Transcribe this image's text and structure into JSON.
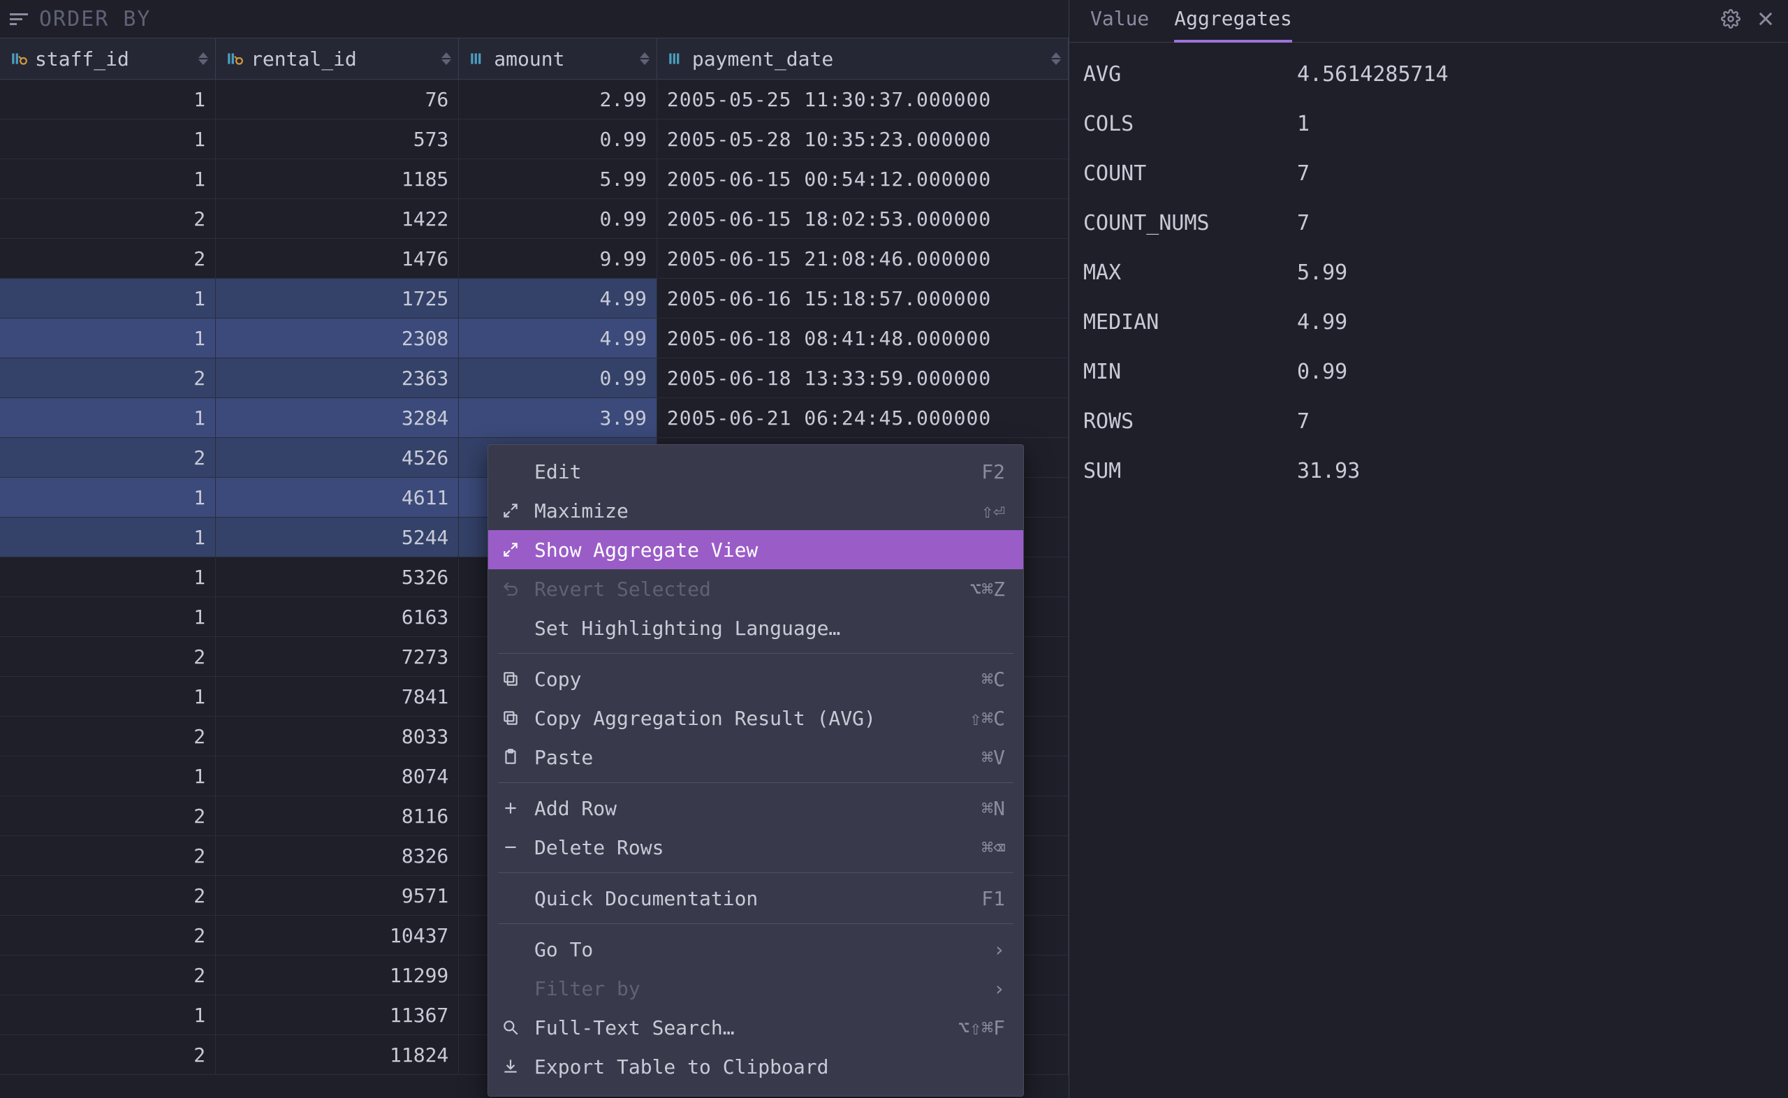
{
  "orderbar": {
    "label": "ORDER BY"
  },
  "columns": [
    {
      "name": "staff_id",
      "icon": "fk"
    },
    {
      "name": "rental_id",
      "icon": "fk"
    },
    {
      "name": "amount",
      "icon": "col"
    },
    {
      "name": "payment_date",
      "icon": "col"
    }
  ],
  "rows": [
    {
      "staff_id": "1",
      "rental_id": "76",
      "amount": "2.99",
      "payment_date": "2005-05-25 11:30:37.000000",
      "sel": false
    },
    {
      "staff_id": "1",
      "rental_id": "573",
      "amount": "0.99",
      "payment_date": "2005-05-28 10:35:23.000000",
      "sel": false
    },
    {
      "staff_id": "1",
      "rental_id": "1185",
      "amount": "5.99",
      "payment_date": "2005-06-15 00:54:12.000000",
      "sel": false
    },
    {
      "staff_id": "2",
      "rental_id": "1422",
      "amount": "0.99",
      "payment_date": "2005-06-15 18:02:53.000000",
      "sel": false
    },
    {
      "staff_id": "2",
      "rental_id": "1476",
      "amount": "9.99",
      "payment_date": "2005-06-15 21:08:46.000000",
      "sel": false
    },
    {
      "staff_id": "1",
      "rental_id": "1725",
      "amount": "4.99",
      "payment_date": "2005-06-16 15:18:57.000000",
      "sel": true
    },
    {
      "staff_id": "1",
      "rental_id": "2308",
      "amount": "4.99",
      "payment_date": "2005-06-18 08:41:48.000000",
      "sel": true
    },
    {
      "staff_id": "2",
      "rental_id": "2363",
      "amount": "0.99",
      "payment_date": "2005-06-18 13:33:59.000000",
      "sel": true
    },
    {
      "staff_id": "1",
      "rental_id": "3284",
      "amount": "3.99",
      "payment_date": "2005-06-21 06:24:45.000000",
      "sel": true
    },
    {
      "staff_id": "2",
      "rental_id": "4526",
      "amount": "",
      "payment_date": "",
      "sel": true
    },
    {
      "staff_id": "1",
      "rental_id": "4611",
      "amount": "",
      "payment_date": "",
      "sel": true
    },
    {
      "staff_id": "1",
      "rental_id": "5244",
      "amount": "",
      "payment_date": "",
      "sel": true
    },
    {
      "staff_id": "1",
      "rental_id": "5326",
      "amount": "",
      "payment_date": "",
      "sel": false
    },
    {
      "staff_id": "1",
      "rental_id": "6163",
      "amount": "",
      "payment_date": "",
      "sel": false
    },
    {
      "staff_id": "2",
      "rental_id": "7273",
      "amount": "",
      "payment_date": "",
      "sel": false
    },
    {
      "staff_id": "1",
      "rental_id": "7841",
      "amount": "",
      "payment_date": "",
      "sel": false
    },
    {
      "staff_id": "2",
      "rental_id": "8033",
      "amount": "",
      "payment_date": "",
      "sel": false
    },
    {
      "staff_id": "1",
      "rental_id": "8074",
      "amount": "",
      "payment_date": "",
      "sel": false
    },
    {
      "staff_id": "2",
      "rental_id": "8116",
      "amount": "",
      "payment_date": "",
      "sel": false
    },
    {
      "staff_id": "2",
      "rental_id": "8326",
      "amount": "",
      "payment_date": "",
      "sel": false
    },
    {
      "staff_id": "2",
      "rental_id": "9571",
      "amount": "",
      "payment_date": "",
      "sel": false
    },
    {
      "staff_id": "2",
      "rental_id": "10437",
      "amount": "",
      "payment_date": "",
      "sel": false
    },
    {
      "staff_id": "2",
      "rental_id": "11299",
      "amount": "",
      "payment_date": "",
      "sel": false
    },
    {
      "staff_id": "1",
      "rental_id": "11367",
      "amount": "",
      "payment_date": "",
      "sel": false
    },
    {
      "staff_id": "2",
      "rental_id": "11824",
      "amount": "",
      "payment_date": "",
      "sel": false
    }
  ],
  "panel": {
    "tabs": {
      "value": "Value",
      "aggregates": "Aggregates"
    },
    "aggregates": [
      {
        "key": "AVG",
        "val": "4.5614285714"
      },
      {
        "key": "COLS",
        "val": "1"
      },
      {
        "key": "COUNT",
        "val": "7"
      },
      {
        "key": "COUNT_NUMS",
        "val": "7"
      },
      {
        "key": "MAX",
        "val": "5.99"
      },
      {
        "key": "MEDIAN",
        "val": "4.99"
      },
      {
        "key": "MIN",
        "val": "0.99"
      },
      {
        "key": "ROWS",
        "val": "7"
      },
      {
        "key": "SUM",
        "val": "31.93"
      }
    ]
  },
  "menu": [
    {
      "type": "item",
      "icon": "",
      "label": "Edit",
      "key": "F2",
      "state": ""
    },
    {
      "type": "item",
      "icon": "maximize",
      "label": "Maximize",
      "key": "⇧⏎",
      "state": ""
    },
    {
      "type": "item",
      "icon": "maximize",
      "label": "Show Aggregate View",
      "key": "",
      "state": "sel"
    },
    {
      "type": "item",
      "icon": "revert",
      "label": "Revert Selected",
      "key": "⌥⌘Z",
      "state": "disabled"
    },
    {
      "type": "item",
      "icon": "",
      "label": "Set Highlighting Language…",
      "key": "",
      "state": ""
    },
    {
      "type": "sep"
    },
    {
      "type": "item",
      "icon": "copy",
      "label": "Copy",
      "key": "⌘C",
      "state": ""
    },
    {
      "type": "item",
      "icon": "copy",
      "label": "Copy Aggregation Result (AVG)",
      "key": "⇧⌘C",
      "state": ""
    },
    {
      "type": "item",
      "icon": "paste",
      "label": "Paste",
      "key": "⌘V",
      "state": ""
    },
    {
      "type": "sep"
    },
    {
      "type": "item",
      "icon": "plus",
      "label": "Add Row",
      "key": "⌘N",
      "state": ""
    },
    {
      "type": "item",
      "icon": "minus",
      "label": "Delete Rows",
      "key": "⌘⌫",
      "state": ""
    },
    {
      "type": "sep"
    },
    {
      "type": "item",
      "icon": "",
      "label": "Quick Documentation",
      "key": "F1",
      "state": ""
    },
    {
      "type": "sep"
    },
    {
      "type": "item",
      "icon": "",
      "label": "Go To",
      "key": "›",
      "state": "",
      "sub": true
    },
    {
      "type": "item",
      "icon": "",
      "label": "Filter by",
      "key": "›",
      "state": "disabled",
      "sub": true
    },
    {
      "type": "item",
      "icon": "search",
      "label": "Full-Text Search…",
      "key": "⌥⇧⌘F",
      "state": ""
    },
    {
      "type": "item",
      "icon": "export",
      "label": "Export Table to Clipboard",
      "key": "",
      "state": ""
    }
  ]
}
